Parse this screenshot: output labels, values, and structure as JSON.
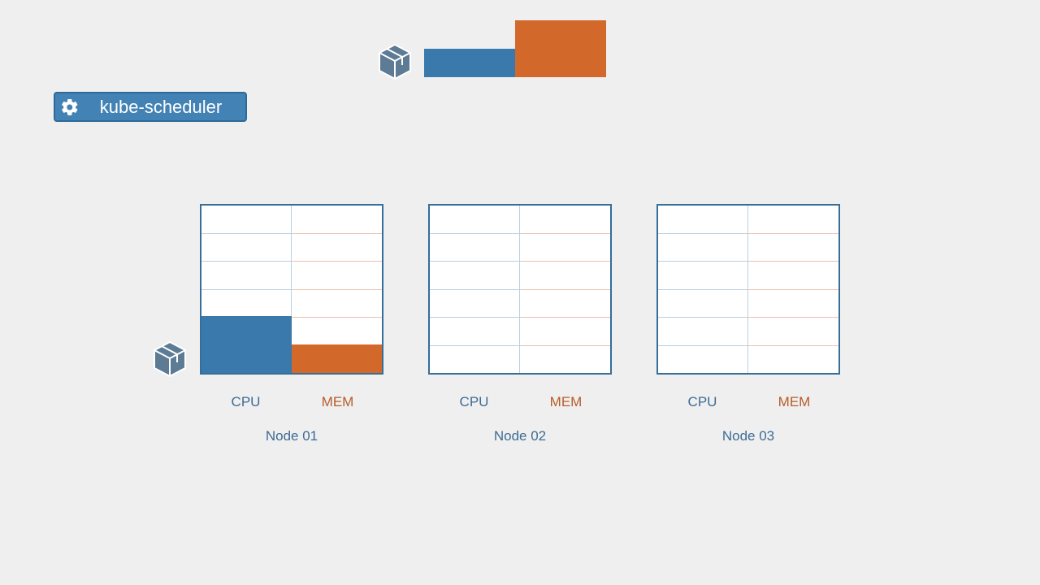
{
  "scheduler": {
    "label": "kube-scheduler"
  },
  "pending_pod": {
    "cpu_units": 1,
    "mem_units": 2
  },
  "axis": {
    "cpu": "CPU",
    "mem": "MEM"
  },
  "nodes": [
    {
      "name": "Node 01",
      "cpu_used": 2,
      "mem_used": 1,
      "capacity": 6,
      "has_pod_icon": true
    },
    {
      "name": "Node 02",
      "cpu_used": 0,
      "mem_used": 0,
      "capacity": 6,
      "has_pod_icon": false
    },
    {
      "name": "Node 03",
      "cpu_used": 0,
      "mem_used": 0,
      "capacity": 6,
      "has_pod_icon": false
    }
  ],
  "colors": {
    "cpu": "#3a79ab",
    "mem": "#d3682b",
    "border": "#366e9a"
  }
}
